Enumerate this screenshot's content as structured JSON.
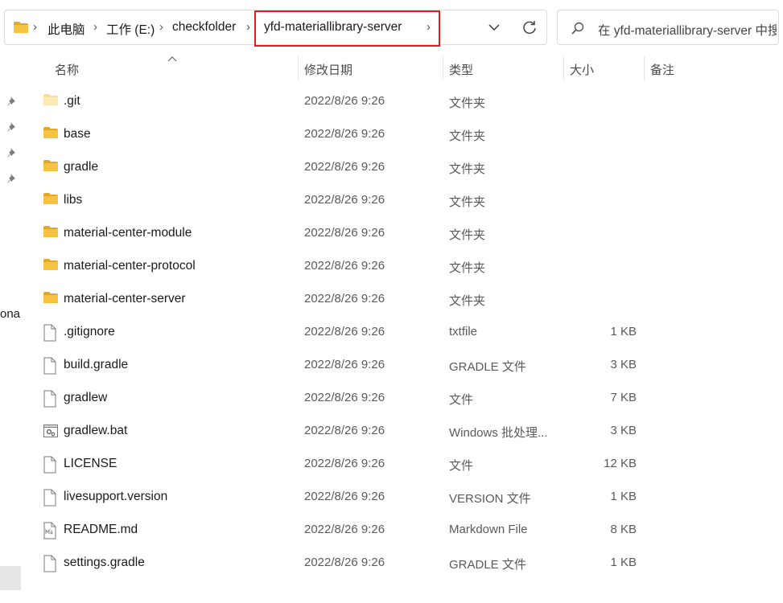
{
  "address_bar": {
    "crumbs": [
      "此电脑",
      "工作 (E:)",
      "checkfolder",
      "yfd-materiallibrary-server"
    ],
    "icons": {
      "root": "folder-icon",
      "separator": "chevron-right-icon",
      "dropdown": "chevron-down-icon",
      "refresh": "refresh-icon"
    }
  },
  "search": {
    "placeholder": "在 yfd-materiallibrary-server 中搜索",
    "icon": "search-icon"
  },
  "sidebar": {
    "clipped_label": "ona",
    "pins": [
      "pin-icon",
      "pin-icon",
      "pin-icon",
      "pin-icon"
    ]
  },
  "columns": {
    "name": "名称",
    "modified": "修改日期",
    "type": "类型",
    "size": "大小",
    "note": "备注"
  },
  "files": [
    {
      "name": ".git",
      "modified": "2022/8/26 9:26",
      "type": "文件夹",
      "size": "",
      "icon": "folder-icon",
      "kind": "folder-hidden"
    },
    {
      "name": "base",
      "modified": "2022/8/26 9:26",
      "type": "文件夹",
      "size": "",
      "icon": "folder-icon",
      "kind": "folder"
    },
    {
      "name": "gradle",
      "modified": "2022/8/26 9:26",
      "type": "文件夹",
      "size": "",
      "icon": "folder-icon",
      "kind": "folder"
    },
    {
      "name": "libs",
      "modified": "2022/8/26 9:26",
      "type": "文件夹",
      "size": "",
      "icon": "folder-icon",
      "kind": "folder"
    },
    {
      "name": "material-center-module",
      "modified": "2022/8/26 9:26",
      "type": "文件夹",
      "size": "",
      "icon": "folder-icon",
      "kind": "folder"
    },
    {
      "name": "material-center-protocol",
      "modified": "2022/8/26 9:26",
      "type": "文件夹",
      "size": "",
      "icon": "folder-icon",
      "kind": "folder"
    },
    {
      "name": "material-center-server",
      "modified": "2022/8/26 9:26",
      "type": "文件夹",
      "size": "",
      "icon": "folder-icon",
      "kind": "folder"
    },
    {
      "name": ".gitignore",
      "modified": "2022/8/26 9:26",
      "type": "txtfile",
      "size": "1 KB",
      "icon": "file-icon",
      "kind": "file"
    },
    {
      "name": "build.gradle",
      "modified": "2022/8/26 9:26",
      "type": "GRADLE 文件",
      "size": "3 KB",
      "icon": "file-icon",
      "kind": "file"
    },
    {
      "name": "gradlew",
      "modified": "2022/8/26 9:26",
      "type": "文件",
      "size": "7 KB",
      "icon": "file-icon",
      "kind": "file"
    },
    {
      "name": "gradlew.bat",
      "modified": "2022/8/26 9:26",
      "type": "Windows 批处理...",
      "size": "3 KB",
      "icon": "batch-file-icon",
      "kind": "bat"
    },
    {
      "name": "LICENSE",
      "modified": "2022/8/26 9:26",
      "type": "文件",
      "size": "12 KB",
      "icon": "file-icon",
      "kind": "file"
    },
    {
      "name": "livesupport.version",
      "modified": "2022/8/26 9:26",
      "type": "VERSION 文件",
      "size": "1 KB",
      "icon": "file-icon",
      "kind": "file"
    },
    {
      "name": "README.md",
      "modified": "2022/8/26 9:26",
      "type": "Markdown File",
      "size": "8 KB",
      "icon": "markdown-file-icon",
      "kind": "md"
    },
    {
      "name": "settings.gradle",
      "modified": "2022/8/26 9:26",
      "type": "GRADLE 文件",
      "size": "1 KB",
      "icon": "file-icon",
      "kind": "file"
    }
  ],
  "colors": {
    "folder": "#f5c242",
    "folder_dark": "#e2a928",
    "highlight_box": "#e0201f"
  }
}
